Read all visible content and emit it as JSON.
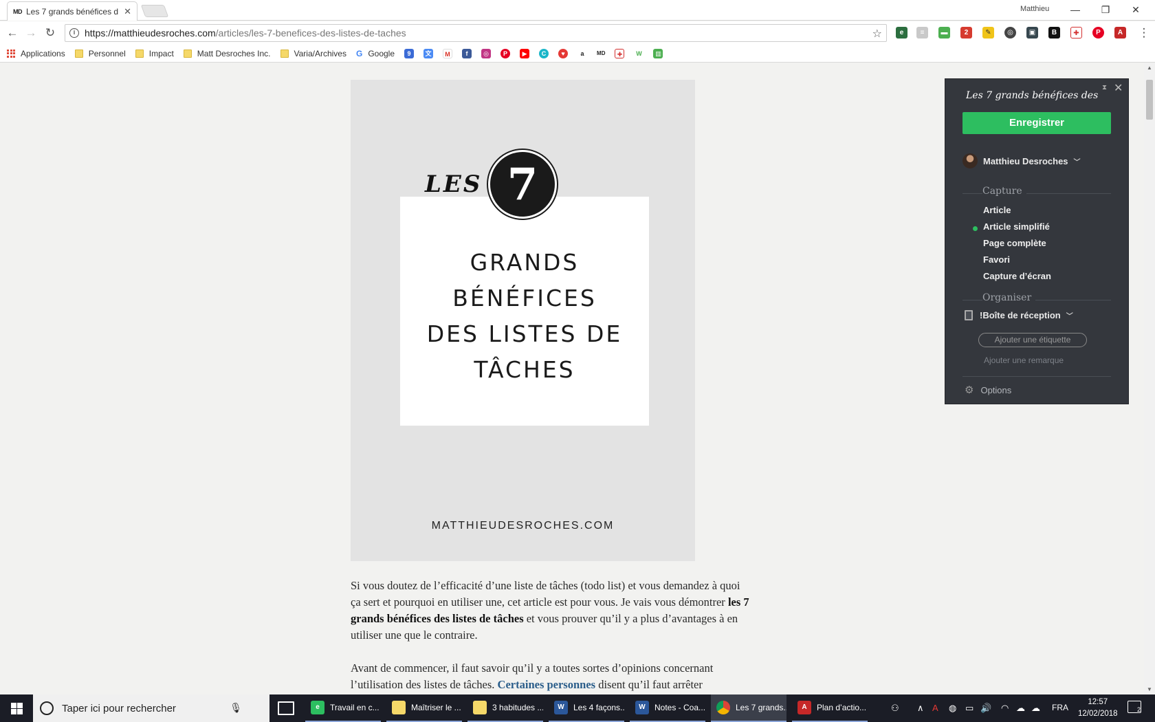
{
  "window": {
    "tab_title": "Les 7 grands bénéfices d",
    "tab_favicon": "MD",
    "user": "Matthieu"
  },
  "toolbar": {
    "url_host": "https://matthieudesroches.com",
    "url_path": "/articles/les-7-benefices-des-listes-de-taches",
    "extension_badge": "2"
  },
  "bookmarks": {
    "apps": "Applications",
    "personnel": "Personnel",
    "impact": "Impact",
    "matt": "Matt Desroches Inc.",
    "varia": "Varia/Archives",
    "google": "Google",
    "md": "MD"
  },
  "hero": {
    "les": "LES",
    "number": "7",
    "line1": "GRANDS",
    "line2": "BÉNÉFICES",
    "line3": "DES LISTES DE",
    "line4": "TÂCHES",
    "site": "MATTHIEUDESROCHES.COM"
  },
  "article": {
    "p1_a": "Si vous doutez de l’efficacité d’une liste de tâches (todo list) et vous demandez à quoi ça sert et pourquoi en utiliser une, cet article est pour vous. Je vais vous démontrer ",
    "p1_bold": "les 7 grands bénéfices des listes de tâches",
    "p1_b": " et vous prouver qu’il y a plus d’avantages à en utiliser une que le contraire.",
    "p2_a": "Avant de commencer, il faut savoir qu’il y a toutes sortes d’opinions concernant l’utilisation des listes de tâches. ",
    "p2_link": "Certaines personnes",
    "p2_b": " disent qu’il faut arrêter"
  },
  "clipper": {
    "title": "Les 7 grands bénéfices des",
    "save": "Enregistrer",
    "user": "Matthieu Desroches",
    "capture_heading": "Capture",
    "capture_options": [
      "Article",
      "Article simplifié",
      "Page complète",
      "Favori",
      "Capture d’écran"
    ],
    "selected_option": "Article simplifié",
    "organize_heading": "Organiser",
    "notebook": "!Boîte de réception",
    "tag_placeholder": "Ajouter une étiquette",
    "note_placeholder": "Ajouter une remarque",
    "options": "Options"
  },
  "taskbar": {
    "search_placeholder": "Taper ici pour rechercher",
    "tasks": [
      "Travail en c...",
      "Maîtriser le ...",
      "3 habitudes ...",
      "Les 4 façons...",
      "Notes - Coa...",
      "Les 7 grands...",
      "Plan d’actio..."
    ],
    "lang": "FRA",
    "time": "12:57",
    "date": "12/02/2018",
    "notifications": "2"
  },
  "colors": {
    "accent_green": "#2dbe60",
    "panel_bg": "#34373d",
    "link_blue": "#2a5d8a"
  }
}
